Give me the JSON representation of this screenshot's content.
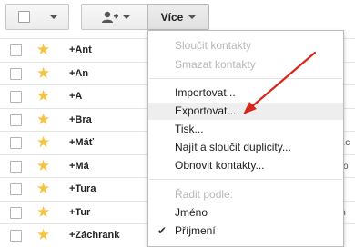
{
  "toolbar": {
    "more_label": "Více"
  },
  "contacts": [
    {
      "name": "+Ant",
      "email": ""
    },
    {
      "name": "+An",
      "email": ""
    },
    {
      "name": "+A",
      "email": ""
    },
    {
      "name": "+Bra",
      "email": ""
    },
    {
      "name": "+Máť",
      "email": "il.c"
    },
    {
      "name": "+Má",
      "email": "co"
    },
    {
      "name": "+Tura",
      "email": "e"
    },
    {
      "name": "+Tur",
      "email": "in"
    },
    {
      "name": "+Záchranka",
      "email": ""
    }
  ],
  "menu": {
    "merge": "Sloučit kontakty",
    "delete": "Smazat kontakty",
    "import": "Importovat...",
    "export": "Exportovat...",
    "print": "Tisk...",
    "find_duplicates": "Najít a sloučit duplicity...",
    "restore": "Obnovit kontakty...",
    "sort_by": "Řadit podle:",
    "sort_first": "Jméno",
    "sort_last": "Příjmení",
    "checkmark": "✔"
  },
  "colors": {
    "star": "#f5c443",
    "arrow": "#d9261c",
    "disabled_text": "#b8b8b8",
    "highlight": "#eeeeee"
  },
  "icons": {
    "add_contact": "person-plus-icon",
    "star": "star-icon",
    "dropdown": "caret-down-icon"
  }
}
